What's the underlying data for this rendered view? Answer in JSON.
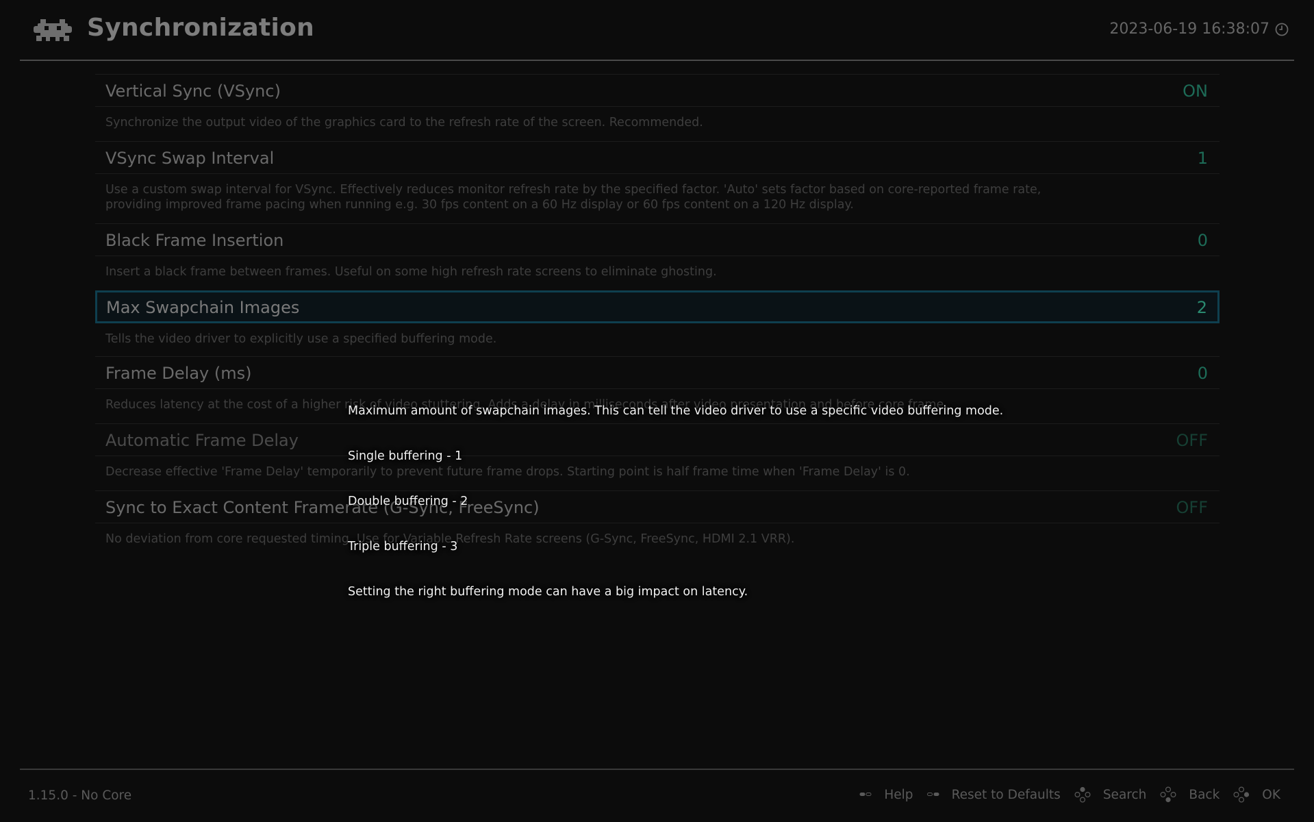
{
  "header": {
    "title": "Synchronization",
    "datetime": "2023-06-19 16:38:07",
    "logo_icon": "retroarch-invader-icon",
    "clock_icon": "clock-icon"
  },
  "settings": [
    {
      "label": "Vertical Sync (VSync)",
      "value": "ON",
      "description": "Synchronize the output video of the graphics card to the refresh rate of the screen. Recommended."
    },
    {
      "label": "VSync Swap Interval",
      "value": "1",
      "description": "Use a custom swap interval for VSync. Effectively reduces monitor refresh rate by the specified factor. 'Auto' sets factor based on core-reported frame rate,",
      "description2": "providing improved frame pacing when running e.g. 30 fps content on a 60 Hz display or 60 fps content on a 120 Hz display."
    },
    {
      "label": "Black Frame Insertion",
      "value": "0",
      "description": "Insert a black frame between frames. Useful on some high refresh rate screens to eliminate ghosting."
    },
    {
      "label": "Max Swapchain Images",
      "value": "2",
      "description": "Tells the video driver to explicitly use a specified buffering mode.",
      "selected": true
    },
    {
      "label": "Frame Delay (ms)",
      "value": "0",
      "description": "Reduces latency at the cost of a higher risk of video stuttering. Adds a delay in milliseconds after video presentation and before core frame."
    },
    {
      "label": "Automatic Frame Delay",
      "value": "OFF",
      "description": "Decrease effective 'Frame Delay' temporarily to prevent future frame drops. Starting point is half frame time when 'Frame Delay' is 0."
    },
    {
      "label": "Sync to Exact Content Framerate (G-Sync, FreeSync)",
      "value": "OFF",
      "description": "No deviation from core requested timing. Use for Variable Refresh Rate screens (G-Sync, FreeSync, HDMI 2.1 VRR)."
    }
  ],
  "tooltip": {
    "lines": [
      "Maximum amount of swapchain images. This can tell the video driver to use a specific video buffering mode.",
      "Single buffering - 1",
      "Double buffering - 2",
      "Triple buffering - 3",
      "Setting the right buffering mode can have a big impact on latency."
    ]
  },
  "footer": {
    "version": "1.15.0 - No Core",
    "hints": [
      {
        "icon": "select-button-icon",
        "label": "Help"
      },
      {
        "icon": "start-button-icon",
        "label": "Reset to Defaults"
      },
      {
        "icon": "gamepad-y-button-icon",
        "label": "Search"
      },
      {
        "icon": "gamepad-b-button-icon",
        "label": "Back"
      },
      {
        "icon": "gamepad-a-button-icon",
        "label": "OK"
      }
    ]
  },
  "colors": {
    "background": "#0c0c0c",
    "value_on": "#1d6b57",
    "value_off": "#163f33",
    "selection_border": "#0f3f4f"
  }
}
